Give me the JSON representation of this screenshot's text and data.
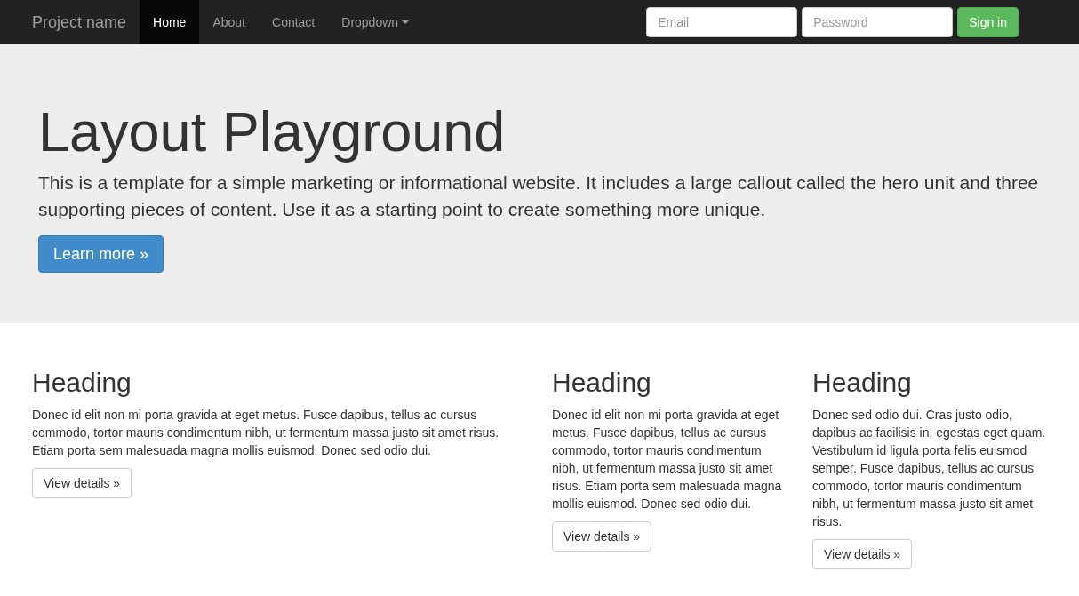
{
  "navbar": {
    "brand": "Project name",
    "items": [
      {
        "label": "Home",
        "selected": true,
        "kind": "link"
      },
      {
        "label": "About",
        "selected": false,
        "kind": "link"
      },
      {
        "label": "Contact",
        "selected": false,
        "kind": "link"
      },
      {
        "label": "Dropdown",
        "selected": false,
        "kind": "dropdown"
      }
    ],
    "email": {
      "placeholder": "Email"
    },
    "password": {
      "placeholder": "Password"
    },
    "sign_in": "Sign in"
  },
  "hero": {
    "title": "Layout Playground",
    "text": "This is a template for a simple marketing or informational website. It includes a large callout called the hero unit and three supporting pieces of content. Use it as a starting point to create something more unique.",
    "button": "Learn more »"
  },
  "columns": [
    {
      "heading": "Heading",
      "text": "Donec id elit non mi porta gravida at eget metus. Fusce dapibus, tellus ac cursus commodo, tortor mauris condimentum nibh, ut fermentum massa justo sit amet risus. Etiam porta sem malesuada magna mollis euismod. Donec sed odio dui.",
      "button": "View details »"
    },
    {
      "heading": "Heading",
      "text": "Donec id elit non mi porta gravida at eget metus. Fusce dapibus, tellus ac cursus commodo, tortor mauris condimentum nibh, ut fermentum massa justo sit amet risus. Etiam porta sem malesuada magna mollis euismod. Donec sed odio dui.",
      "button": "View details »"
    },
    {
      "heading": "Heading",
      "text": "Donec sed odio dui. Cras justo odio, dapibus ac facilisis in, egestas eget quam. Vestibulum id ligula porta felis euismod semper. Fusce dapibus, tellus ac cursus commodo, tortor mauris condimentum nibh, ut fermentum massa justo sit amet risus.",
      "button": "View details »"
    }
  ]
}
